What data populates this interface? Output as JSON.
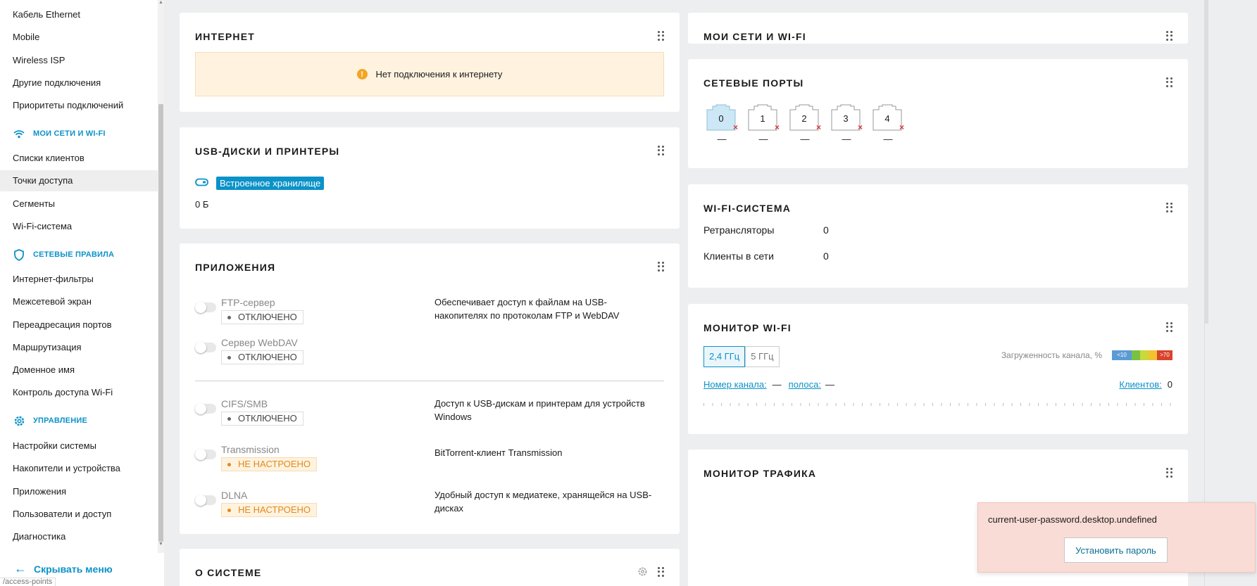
{
  "sidebar": {
    "items_top": [
      "Кабель Ethernet",
      "Mobile",
      "Wireless ISP",
      "Другие подключения",
      "Приоритеты подключений"
    ],
    "sections": [
      {
        "title": "МОИ СЕТИ И WI-FI",
        "icon": "wifi-icon",
        "items": [
          "Списки клиентов",
          "Точки доступа",
          "Сегменты",
          "Wi-Fi-система"
        ]
      },
      {
        "title": "СЕТЕВЫЕ ПРАВИЛА",
        "icon": "shield-icon",
        "items": [
          "Интернет-фильтры",
          "Межсетевой экран",
          "Переадресация портов",
          "Маршрутизация",
          "Доменное имя",
          "Контроль доступа Wi-Fi"
        ]
      },
      {
        "title": "УПРАВЛЕНИЕ",
        "icon": "gear-icon",
        "items": [
          "Настройки системы",
          "Накопители и устройства",
          "Приложения",
          "Пользователи и доступ",
          "Диагностика"
        ]
      }
    ],
    "active_item": "Точки доступа",
    "collapse_label": "Скрывать меню",
    "url_hint": "/access-points"
  },
  "internet": {
    "title": "ИНТЕРНЕТ",
    "warning": "Нет подключения к интернету"
  },
  "usb": {
    "title": "USB-ДИСКИ И ПРИНТЕРЫ",
    "storage_tag": "Встроенное хранилище",
    "size": "0 Б"
  },
  "apps": {
    "title": "ПРИЛОЖЕНИЯ",
    "items": [
      {
        "name": "FTP-сервер",
        "status": "ОТКЛЮЧЕНО",
        "desc": "Обеспечивает доступ к файлам на USB-накопителях по протоколам FTP и WebDAV"
      },
      {
        "name": "Сервер WebDAV",
        "status": "ОТКЛЮЧЕНО",
        "desc": ""
      },
      {
        "name": "CIFS/SMB",
        "status": "ОТКЛЮЧЕНО",
        "desc": "Доступ к USB-дискам и принтерам для устройств Windows"
      },
      {
        "name": "Transmission",
        "status": "НЕ НАСТРОЕНО",
        "desc": "BitTorrent-клиент Transmission"
      },
      {
        "name": "DLNA",
        "status": "НЕ НАСТРОЕНО",
        "desc": "Удобный доступ к медиатеке, хранящейся на USB-дисках"
      }
    ]
  },
  "system": {
    "title": "О СИСТЕМЕ"
  },
  "mynets": {
    "title": "МОИ СЕТИ И WI-FI"
  },
  "ports": {
    "title": "СЕТЕВЫЕ ПОРТЫ",
    "items": [
      {
        "num": "0",
        "val": "—"
      },
      {
        "num": "1",
        "val": "—"
      },
      {
        "num": "2",
        "val": "—"
      },
      {
        "num": "3",
        "val": "—"
      },
      {
        "num": "4",
        "val": "—"
      }
    ],
    "x_mark": "×",
    "active_color": "#cce7f5"
  },
  "wifisys": {
    "title": "WI-FI-СИСТЕМА",
    "rows": [
      {
        "label": "Ретрансляторы",
        "value": "0"
      },
      {
        "label": "Клиенты в сети",
        "value": "0"
      }
    ]
  },
  "wifimon": {
    "title": "МОНИТОР WI-FI",
    "bands": [
      "2,4 ГГц",
      "5 ГГц"
    ],
    "selected_band": "2,4 ГГц",
    "load_label": "Загруженность канала, %",
    "load_low": "<10",
    "load_high": ">70",
    "channel_label": "Номер канала:",
    "channel_value": "—",
    "width_label": "полоса:",
    "width_value": "—",
    "clients_label": "Клиентов:",
    "clients_value": "0"
  },
  "trafmon": {
    "title": "МОНИТОР ТРАФИКА"
  },
  "toast": {
    "message": "current-user-password.desktop.undefined",
    "button": "Установить пароль"
  },
  "colors": {
    "accent": "#0b92c8",
    "warning_bg": "#fff3e0",
    "error_bg": "#fadcd6"
  }
}
